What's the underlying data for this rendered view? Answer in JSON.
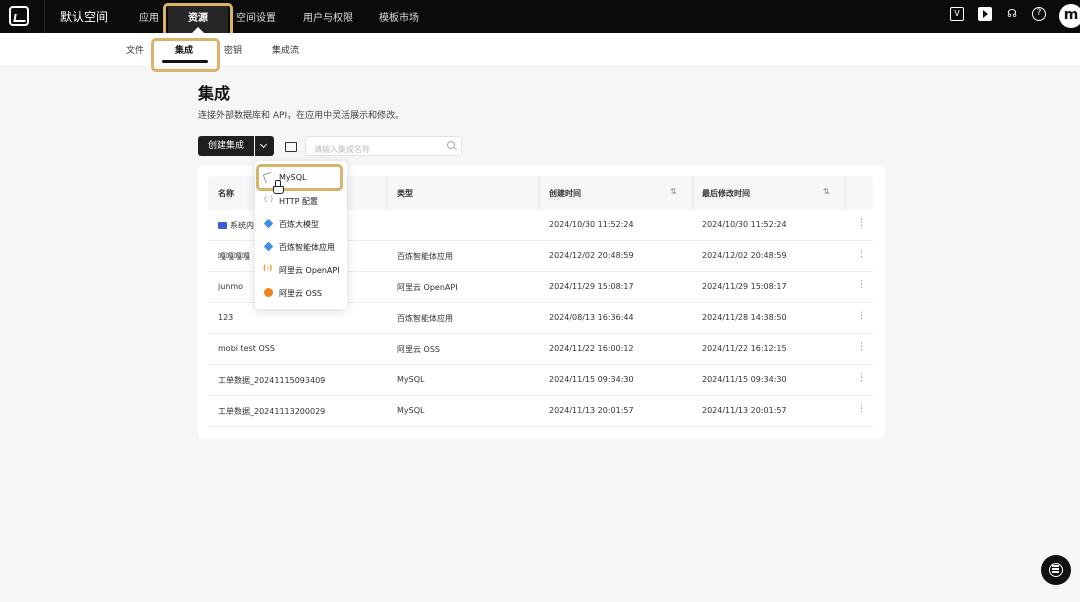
{
  "topbar": {
    "space_name": "默认空间",
    "nav": [
      "应用",
      "资源",
      "空间设置",
      "用户与权限",
      "模板市场"
    ],
    "active_nav": "资源",
    "avatar_letter": "m",
    "icons": [
      "v-badge-icon",
      "play-icon",
      "headset-icon",
      "help-icon"
    ]
  },
  "subnav": {
    "items": [
      "文件",
      "集成",
      "密钥",
      "集成流"
    ],
    "active": "集成"
  },
  "header": {
    "title": "集成",
    "description": "连接外部数据库和 API，在应用中灵活展示和修改。"
  },
  "toolbar": {
    "create_label": "创建集成",
    "search_placeholder": "请输入集成名称"
  },
  "table": {
    "columns": [
      "名称",
      "类型",
      "创建时间",
      "最后修改时间"
    ],
    "rows": [
      {
        "name": "系统内",
        "type": "",
        "created": "2024/10/30 11:52:24",
        "modified": "2024/10/30 11:52:24",
        "is_folder": true
      },
      {
        "name": "嘎嘎嘎嘎",
        "type": "百炼智能体应用",
        "created": "2024/12/02 20:48:59",
        "modified": "2024/12/02 20:48:59"
      },
      {
        "name": "junmo",
        "type": "阿里云 OpenAPI",
        "created": "2024/11/29 15:08:17",
        "modified": "2024/11/29 15:08:17"
      },
      {
        "name": "123",
        "type": "百炼智能体应用",
        "created": "2024/08/13 16:36:44",
        "modified": "2024/11/28 14:38:50"
      },
      {
        "name": "mobi test OSS",
        "type": "阿里云 OSS",
        "created": "2024/11/22 16:00:12",
        "modified": "2024/11/22 16:12:15"
      },
      {
        "name": "工单数据_20241115093409",
        "type": "MySQL",
        "created": "2024/11/15 09:34:30",
        "modified": "2024/11/15 09:34:30"
      },
      {
        "name": "工单数据_20241113200029",
        "type": "MySQL",
        "created": "2024/11/13 20:01:57",
        "modified": "2024/11/13 20:01:57"
      }
    ]
  },
  "dropdown": {
    "items": [
      {
        "label": "MySQL",
        "icon": "mysql-icon"
      },
      {
        "label": "HTTP 配置",
        "icon": "http-icon"
      },
      {
        "label": "百炼大模型",
        "icon": "bailian-model-icon"
      },
      {
        "label": "百炼智能体应用",
        "icon": "bailian-agent-icon"
      },
      {
        "label": "阿里云 OpenAPI",
        "icon": "aliyun-openapi-icon"
      },
      {
        "label": "阿里云 OSS",
        "icon": "aliyun-oss-icon"
      }
    ]
  },
  "colors": {
    "highlight": "#d9b36a",
    "topbar_bg": "#0b0b0b",
    "accent_folder": "#3a5bd8",
    "aliyun_orange": "#f0841b"
  }
}
